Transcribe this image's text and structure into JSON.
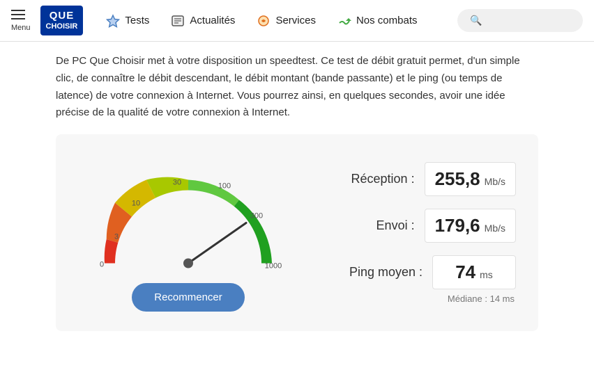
{
  "header": {
    "menu_label": "Menu",
    "logo_line1": "QUE",
    "logo_line2": "CHOISIR",
    "nav_items": [
      {
        "id": "tests",
        "label": "Tests",
        "icon": "star"
      },
      {
        "id": "actualites",
        "label": "Actualités",
        "icon": "news"
      },
      {
        "id": "services",
        "label": "Services",
        "icon": "tools"
      },
      {
        "id": "nos-combats",
        "label": "Nos combats",
        "icon": "megaphone"
      }
    ],
    "search_placeholder": "Rechercher"
  },
  "page": {
    "description": "De PC Que Choisir met à votre disposition un speedtest. Ce test de débit gratuit permet, d'un simple clic, de connaître le débit descendant, le débit montant (bande passante) et le ping (ou temps de latence) de votre connexion à Internet. Vous pourrez ainsi, en quelques secondes, avoir une idée précise de la qualité de votre connexion à Internet."
  },
  "speedtest": {
    "gauge": {
      "labels": [
        "0",
        "3",
        "10",
        "30",
        "100",
        "300",
        "1000"
      ],
      "needle_angle": 162
    },
    "reception_label": "Réception :",
    "reception_value": "255,8",
    "reception_unit": "Mb/s",
    "envoi_label": "Envoi :",
    "envoi_value": "179,6",
    "envoi_unit": "Mb/s",
    "ping_label": "Ping moyen :",
    "ping_value": "74",
    "ping_unit": "ms",
    "mediane": "Médiane : 14 ms",
    "recommencer_label": "Recommencer"
  }
}
